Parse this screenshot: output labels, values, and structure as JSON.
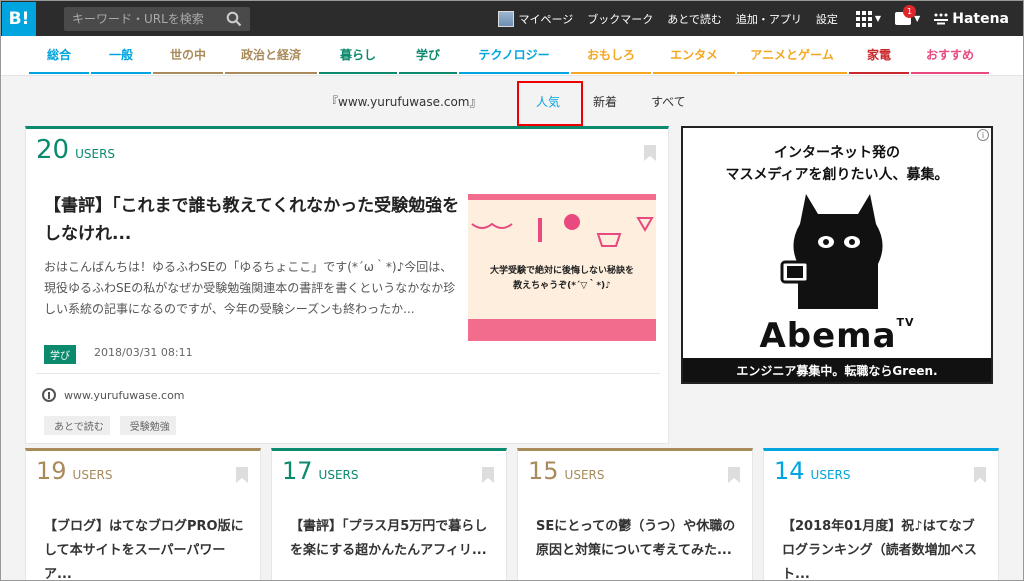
{
  "header": {
    "logo": "B!",
    "search_placeholder": "キーワード・URLを検索",
    "mypage": "マイページ",
    "links": [
      "ブックマーク",
      "あとで読む",
      "追加・アプリ",
      "設定"
    ],
    "notification_count": "1",
    "brand": "Hatena"
  },
  "categories": [
    {
      "label": "総合",
      "color": "#00a4de",
      "width": 60
    },
    {
      "label": "一般",
      "color": "#00a4de",
      "width": 60
    },
    {
      "label": "世の中",
      "color": "#a88a5b",
      "width": 70
    },
    {
      "label": "政治と経済",
      "color": "#a88a5b",
      "width": 92
    },
    {
      "label": "暮らし",
      "color": "#0b8a6d",
      "width": 78
    },
    {
      "label": "学び",
      "color": "#0b8a6d",
      "width": 58
    },
    {
      "label": "テクノロジー",
      "color": "#00a4de",
      "width": 110
    },
    {
      "label": "おもしろ",
      "color": "#f5a623",
      "width": 80
    },
    {
      "label": "エンタメ",
      "color": "#f5a623",
      "width": 82
    },
    {
      "label": "アニメとゲーム",
      "color": "#f5a623",
      "width": 110
    },
    {
      "label": "家電",
      "color": "#c9282d",
      "width": 60
    },
    {
      "label": "おすすめ",
      "color": "#e84a7f",
      "width": 78
    }
  ],
  "subtabs": {
    "site": "『www.yurufuwase.com』",
    "tabs": [
      "人気",
      "新着",
      "すべて"
    ],
    "active": "人気"
  },
  "main_entry": {
    "users": "20",
    "users_label": "USERS",
    "title": "【書評】「これまで誰も教えてくれなかった受験勉強をしなけれ...",
    "description": "おはこんばんちは！ゆるふわSEの「ゆるちょここ」です(*´ω｀*)♪今回は、現役ゆるふわSEの私がなぜか受験勉強関連本の書評を書くというなかなか珍しい系統の記事になるのですが、今年の受験シーズンも終わったか...",
    "category_tag": "学び",
    "date": "2018/03/31 08:11",
    "thumb_text_1": "大学受験で絶対に後悔しない秘訣を",
    "thumb_text_2": "教えちゃうぞ(*´▽｀*)♪",
    "site": "www.yurufuwase.com",
    "chips": [
      "あとで読む",
      "受験勉強"
    ],
    "accent": "#0b8a6d"
  },
  "ad": {
    "line1": "インターネット発の",
    "line2": "マスメディアを創りたい人、募集。",
    "brand": "Abema",
    "brand_suffix": "TV",
    "footer": "エンジニア募集中。転職ならGreen."
  },
  "entries": [
    {
      "users": "19",
      "title": "【ブログ】はてなブログPRO版にして本サイトをスーパーパワーア...",
      "accent": "#a88a5b"
    },
    {
      "users": "17",
      "title": "【書評】「プラス月5万円で暮らしを楽にする超かんたんアフィリ...",
      "accent": "#0b8a6d"
    },
    {
      "users": "15",
      "title": "SEにとっての鬱（うつ）や休職の原因と対策について考えてみた...",
      "accent": "#a88a5b"
    },
    {
      "users": "14",
      "title": "【2018年01月度】祝♪はてなブログランキング（読者数増加ベスト...",
      "accent": "#00a4de"
    }
  ]
}
